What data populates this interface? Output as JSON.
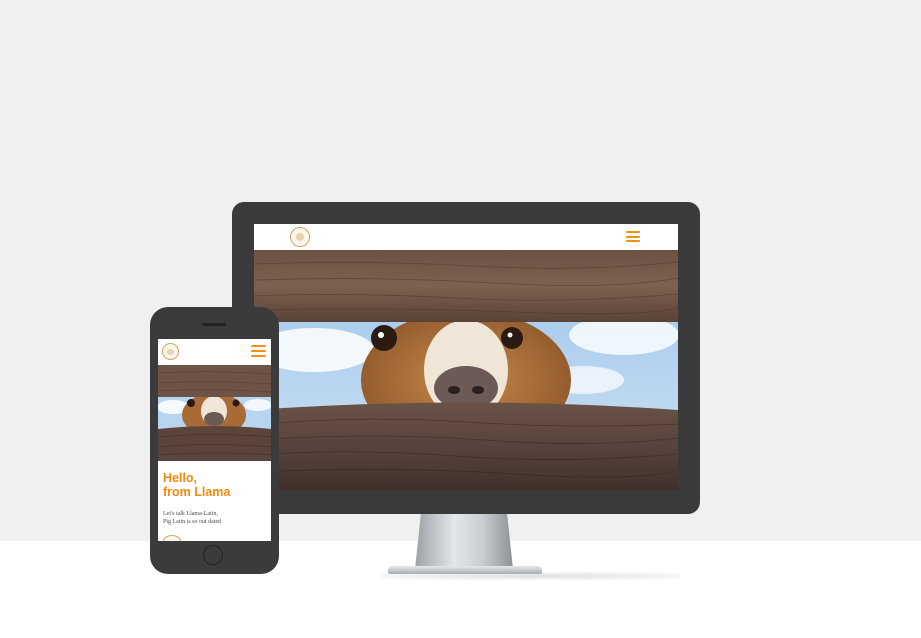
{
  "mockup": {
    "colors": {
      "wall": "#f0f0f0",
      "floor": "#ffffff",
      "device_body": "#3a3a3a",
      "accent": "#f29111",
      "heading": "#ee8a10"
    },
    "desktop": {
      "header": {
        "logo_icon": "llama-logo-icon",
        "menu_icon": "hamburger-menu-icon"
      },
      "hero_image": "llama-peeking-through-wooden-fence"
    },
    "mobile": {
      "header": {
        "logo_icon": "llama-logo-icon",
        "menu_icon": "hamburger-menu-icon"
      },
      "hero_image": "llama-peeking-through-wooden-fence",
      "heading": "Hello,\nfrom Llama",
      "body_text": "Let's talk Llama-Latin,\nPig Latin is so out dated"
    }
  }
}
